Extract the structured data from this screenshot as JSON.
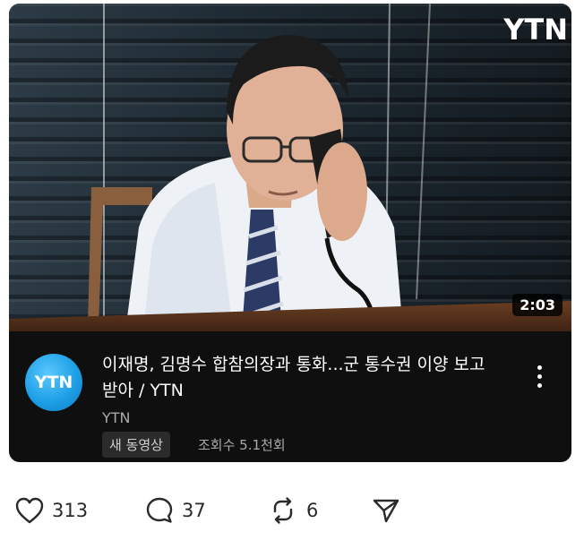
{
  "video": {
    "thumbnail_watermark": "YTN",
    "duration": "2:03",
    "channel_avatar_text": "YTN",
    "title": "이재명, 김명수 합참의장과 통화...군 통수권 이양 보고 받아 / YTN",
    "channel_name": "YTN",
    "new_badge": "새 동영상",
    "views": "조회수 5.1천회",
    "menu_icon": "more-vert-icon"
  },
  "post_actions": {
    "likes": "313",
    "comments": "37",
    "reposts": "6",
    "icons": [
      "heart-icon",
      "comment-icon",
      "repost-icon",
      "share-icon"
    ]
  },
  "colors": {
    "card_background": "#0f0f0f",
    "avatar_blue": "#1ea0e6",
    "title_text": "#ffffff",
    "meta_text": "#aaaaaa"
  }
}
